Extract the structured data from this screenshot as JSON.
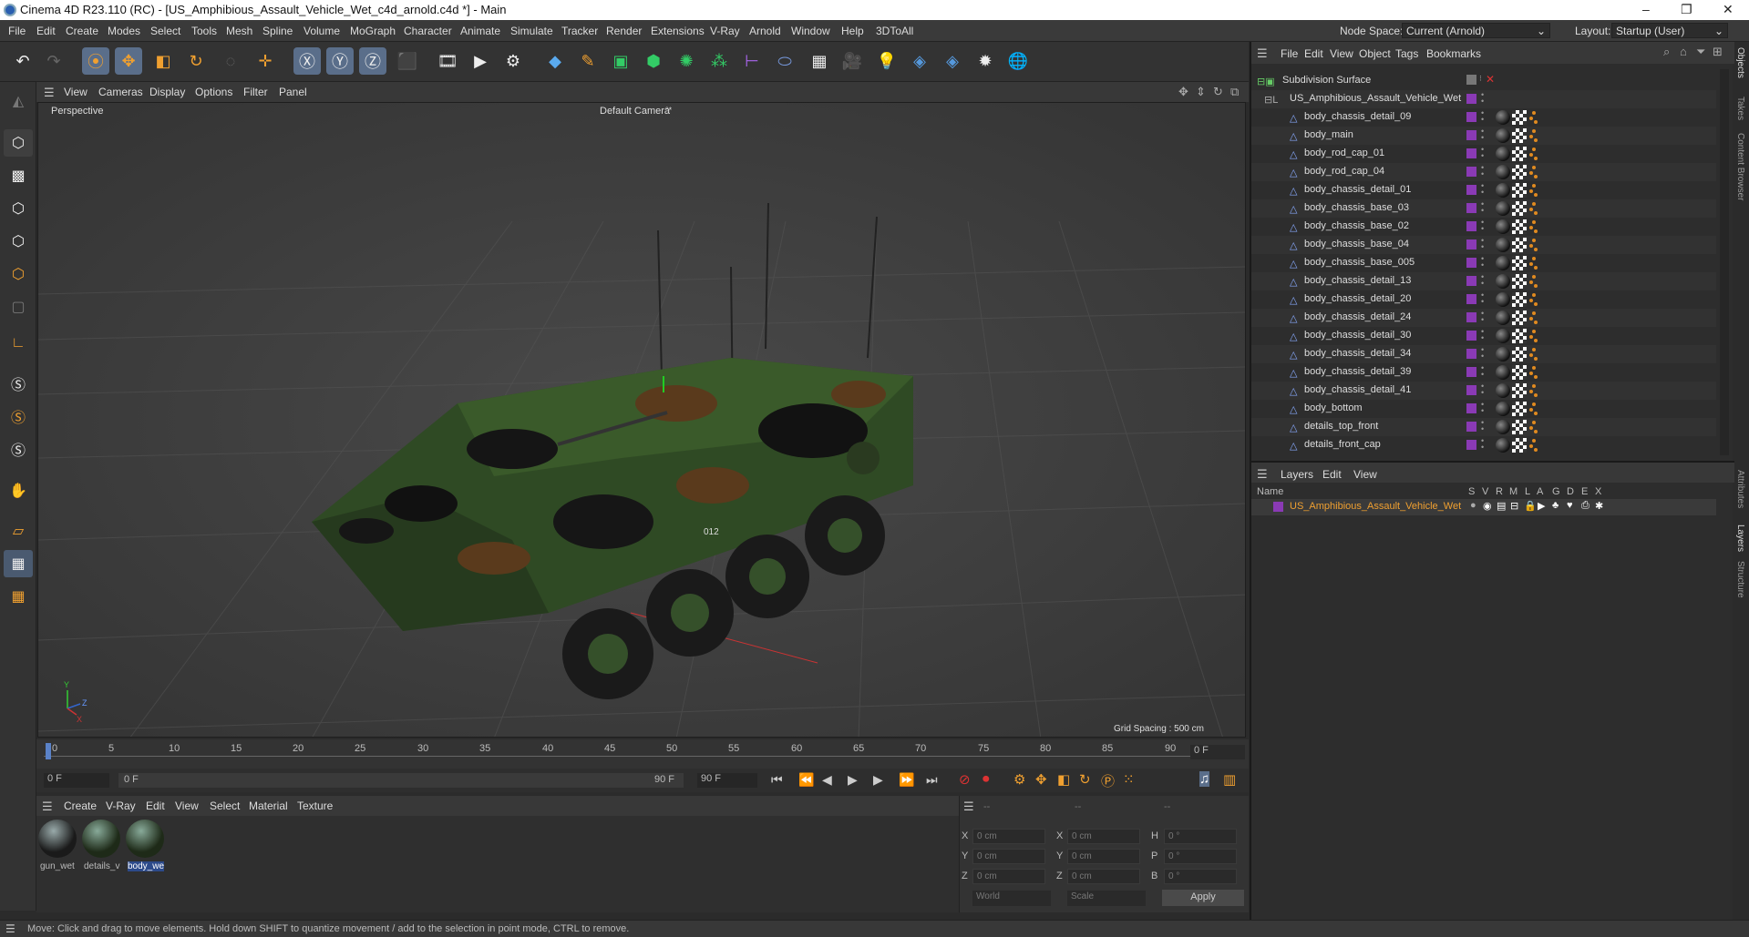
{
  "window": {
    "title": "Cinema 4D R23.110 (RC) - [US_Amphibious_Assault_Vehicle_Wet_c4d_arnold.c4d *] - Main",
    "minimize": "–",
    "maximize": "❐",
    "close": "✕"
  },
  "menubar": {
    "items": [
      "File",
      "Edit",
      "Create",
      "Modes",
      "Select",
      "Tools",
      "Mesh",
      "Spline",
      "Volume",
      "MoGraph",
      "Character",
      "Animate",
      "Simulate",
      "Tracker",
      "Render",
      "Extensions",
      "V-Ray",
      "Arnold",
      "Window",
      "Help",
      "3DToAll"
    ],
    "node_space_label": "Node Space:",
    "node_space_value": "Current (Arnold)",
    "layout_label": "Layout:",
    "layout_value": "Startup (User)"
  },
  "viewport": {
    "menu": [
      "View",
      "Cameras",
      "Display",
      "Options",
      "Filter",
      "Panel"
    ],
    "name": "Perspective",
    "camera": "Default Camera",
    "camera_icon": "°*",
    "grid_spacing": "Grid Spacing : 500 cm",
    "axis_y": "Y",
    "axis_z": "Z",
    "axis_x": "X",
    "model_number": "012"
  },
  "timeline": {
    "ticks": [
      "0",
      "5",
      "10",
      "15",
      "20",
      "25",
      "30",
      "35",
      "40",
      "45",
      "50",
      "55",
      "60",
      "65",
      "70",
      "75",
      "80",
      "85",
      "90"
    ],
    "current_frame": "0 F"
  },
  "playbar": {
    "start": "0 F",
    "range_start": "0 F",
    "range_end": "90 F",
    "end": "90 F"
  },
  "material_manager": {
    "menu": [
      "Create",
      "V-Ray",
      "Edit",
      "View",
      "Select",
      "Material",
      "Texture"
    ],
    "materials": [
      {
        "name": "gun_wet"
      },
      {
        "name": "details_v"
      },
      {
        "name": "body_we"
      }
    ]
  },
  "coordinates": {
    "headers": [
      "--",
      "--",
      "--"
    ],
    "rows": [
      {
        "a": "X",
        "av": "0 cm",
        "b": "X",
        "bv": "0 cm",
        "c": "H",
        "cv": "0 °"
      },
      {
        "a": "Y",
        "av": "0 cm",
        "b": "Y",
        "bv": "0 cm",
        "c": "P",
        "cv": "0 °"
      },
      {
        "a": "Z",
        "av": "0 cm",
        "b": "Z",
        "bv": "0 cm",
        "c": "B",
        "cv": "0 °"
      }
    ],
    "world": "World",
    "scale": "Scale",
    "apply": "Apply"
  },
  "status": "Move: Click and drag to move elements. Hold down SHIFT to quantize movement / add to the selection in point mode, CTRL to remove.",
  "object_manager": {
    "menu": [
      "File",
      "Edit",
      "View",
      "Object",
      "Tags",
      "Bookmarks"
    ],
    "root": "Subdivision Surface",
    "group": "US_Amphibious_Assault_Vehicle_Wet",
    "objects": [
      "body_chassis_detail_09",
      "body_main",
      "body_rod_cap_01",
      "body_rod_cap_04",
      "body_chassis_detail_01",
      "body_chassis_base_03",
      "body_chassis_base_02",
      "body_chassis_base_04",
      "body_chassis_base_005",
      "body_chassis_detail_13",
      "body_chassis_detail_20",
      "body_chassis_detail_24",
      "body_chassis_detail_30",
      "body_chassis_detail_34",
      "body_chassis_detail_39",
      "body_chassis_detail_41",
      "body_bottom",
      "details_top_front",
      "details_front_cap"
    ]
  },
  "layer_manager": {
    "menu": [
      "Layers",
      "Edit",
      "View"
    ],
    "col_name": "Name",
    "cols": [
      "S",
      "V",
      "R",
      "M",
      "L",
      "A",
      "G",
      "D",
      "E",
      "X"
    ],
    "layer": "US_Amphibious_Assault_Vehicle_Wet"
  },
  "side_tabs": [
    "Objects",
    "Takes",
    "Content Browser",
    "Attributes",
    "Layers",
    "Structure"
  ],
  "colors": {
    "accent": "#8a3ab5",
    "orange": "#e08a20",
    "active": "#5a6e8a"
  }
}
